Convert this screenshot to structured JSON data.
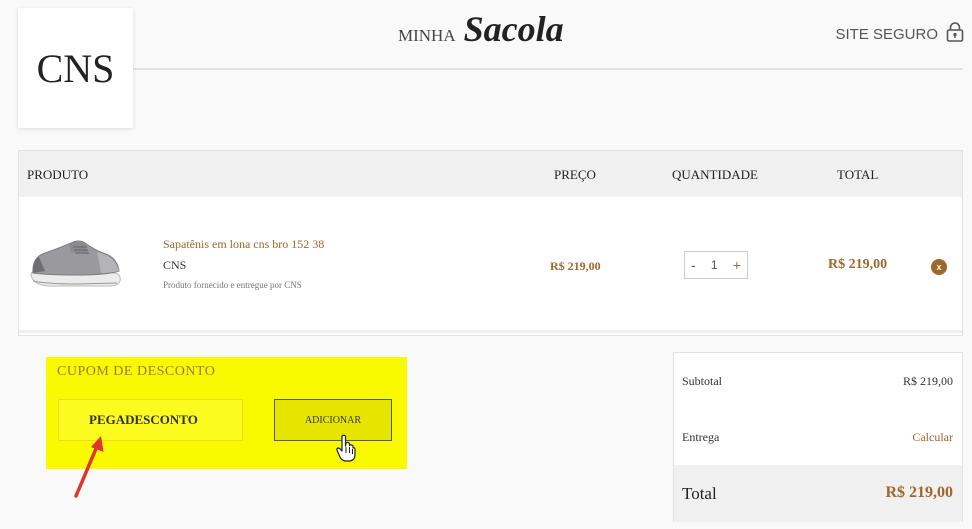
{
  "brand": {
    "logo_text": "CNS"
  },
  "header": {
    "title_small": "MINHA",
    "title_big": "Sacola",
    "secure_label": "SITE SEGURO",
    "secure_icon": "lock-icon"
  },
  "cart": {
    "columns": {
      "product": "PRODUTO",
      "price": "PREÇO",
      "quantity": "QUANTIDADE",
      "total": "TOTAL"
    },
    "items": [
      {
        "name": "Sapatênis em lona cns bro 152 38",
        "brand": "CNS",
        "note": "Produto fornecido e entregue por CNS",
        "price": "R$ 219,00",
        "quantity": "1",
        "qty_minus": "-",
        "qty_plus": "+",
        "total": "R$ 219,00",
        "remove_label": "x"
      }
    ]
  },
  "coupon": {
    "title": "CUPOM DE DESCONTO",
    "value": "PEGADESCONTO",
    "button_label": "ADICIONAR"
  },
  "summary": {
    "subtotal_label": "Subtotal",
    "subtotal_value": "R$ 219,00",
    "delivery_label": "Entrega",
    "delivery_link": "Calcular",
    "total_label": "Total",
    "total_value": "R$ 219,00"
  },
  "colors": {
    "accent": "#a0662b",
    "highlight": "#f9f900",
    "annotation_arrow": "#e0342f"
  }
}
